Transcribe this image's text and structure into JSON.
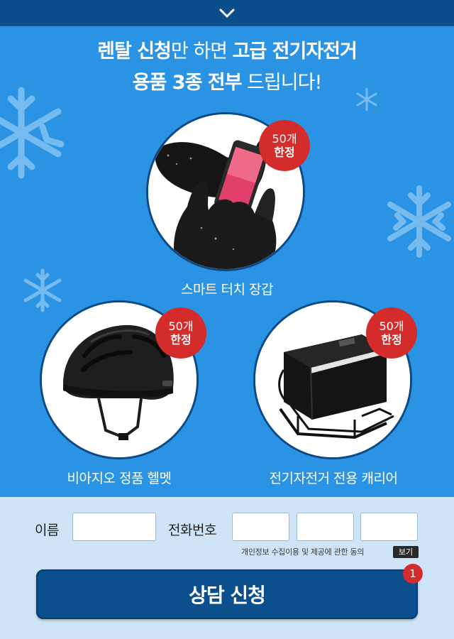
{
  "headline": {
    "line1_a": "렌탈 신청",
    "line1_b": "만 하면 ",
    "line1_c": "고급 전기자전거",
    "line2_a": "용품 3종 전부",
    "line2_b": " 드립니다!"
  },
  "products": [
    {
      "label": "스마트 터치 장갑",
      "badge_count": "50개",
      "badge_limited": "한정"
    },
    {
      "label": "비아지오 정품 헬멧",
      "badge_count": "50개",
      "badge_limited": "한정"
    },
    {
      "label": "전기자전거 전용 캐리어",
      "badge_count": "50개",
      "badge_limited": "한정"
    }
  ],
  "form": {
    "name_label": "이름",
    "phone_label": "전화번호",
    "consent_text": "개인정보 수집이용 및 제공에 관한 동의",
    "view_button": "보기",
    "submit_label": "상담 신청",
    "notification_count": "1"
  },
  "colors": {
    "top_bar": "#0a4f8c",
    "promo_bg": "#2b93e3",
    "badge": "#d42b2b",
    "form_bg": "#cfe5f7",
    "submit_bg": "#0b4f8d"
  }
}
